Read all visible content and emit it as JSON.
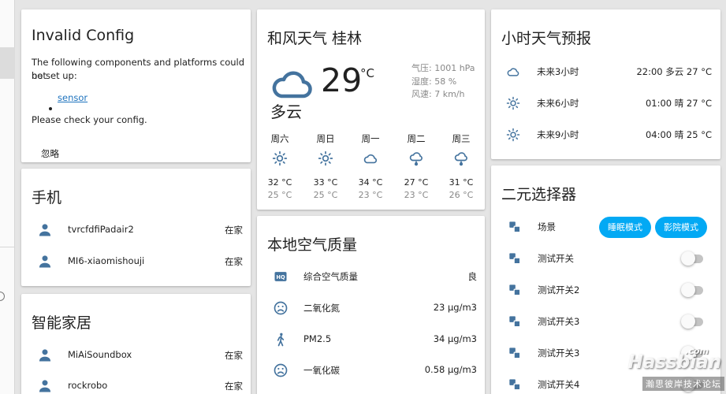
{
  "invalid_config": {
    "title": "Invalid Config",
    "message_line1": "The following components and platforms could not",
    "message_line2": "be set up:",
    "components": [
      "sensor"
    ],
    "check_text": "Please check your config.",
    "dismiss_label": "忽略"
  },
  "phone_card": {
    "title": "手机",
    "items": [
      {
        "icon": "person-icon",
        "name": "tvrcfdfiPadair2",
        "state": "在家"
      },
      {
        "icon": "person-icon",
        "name": "MI6-xiaomishouji",
        "state": "在家"
      }
    ]
  },
  "smart_home_card": {
    "title": "智能家居",
    "items": [
      {
        "icon": "person-icon",
        "name": "MiAiSoundbox",
        "state": "在家"
      },
      {
        "icon": "person-icon",
        "name": "rockrobo",
        "state": "在家"
      }
    ]
  },
  "weather_card": {
    "title": "和风天气 桂林",
    "current_icon": "cloudy-icon",
    "temperature": "29",
    "unit": "°C",
    "condition": "多云",
    "pressure": "气压: 1001 hPa",
    "humidity": "湿度: 58 %",
    "wind": "风速: 7 km/h",
    "forecast": [
      {
        "day": "周六",
        "icon": "sunny-icon",
        "high": "32 °C",
        "low": "25 °C"
      },
      {
        "day": "周日",
        "icon": "sunny-icon",
        "high": "33 °C",
        "low": "25 °C"
      },
      {
        "day": "周一",
        "icon": "cloudy-icon",
        "high": "34 °C",
        "low": "23 °C"
      },
      {
        "day": "周二",
        "icon": "rainy-icon",
        "high": "27 °C",
        "low": "23 °C"
      },
      {
        "day": "周三",
        "icon": "rainy-icon",
        "high": "31 °C",
        "low": "26 °C"
      }
    ]
  },
  "air_quality_card": {
    "title": "本地空气质量",
    "items": [
      {
        "icon": "hq-icon",
        "name": "综合空气质量",
        "value": "良"
      },
      {
        "icon": "sad-face-icon",
        "name": "二氧化氮",
        "value": "23 μg/m3"
      },
      {
        "icon": "walking-icon",
        "name": "PM2.5",
        "value": "34 μg/m3"
      },
      {
        "icon": "sad-face-icon",
        "name": "一氧化碳",
        "value": "0.58 μg/m3"
      }
    ]
  },
  "hourly_card": {
    "title": "小时天气预报",
    "items": [
      {
        "icon": "cloudy-icon",
        "label": "未来3小时",
        "value": "22:00 多云 27 °C"
      },
      {
        "icon": "sunny-icon",
        "label": "未来6小时",
        "value": "01:00 晴 27 °C"
      },
      {
        "icon": "sunny-icon",
        "label": "未来9小时",
        "value": "04:00 晴 25 °C"
      }
    ]
  },
  "binary_selector_card": {
    "title": "二元选择器",
    "scene": {
      "icon": "scene-icon",
      "label": "场景",
      "buttons": [
        "睡眠模式",
        "影院模式"
      ]
    },
    "switches": [
      {
        "icon": "switch-icon",
        "label": "测试开关",
        "on": false
      },
      {
        "icon": "switch-icon",
        "label": "测试开关2",
        "on": false
      },
      {
        "icon": "switch-icon",
        "label": "测试开关3",
        "on": false
      },
      {
        "icon": "switch-icon",
        "label": "测试开关3",
        "on": false
      },
      {
        "icon": "switch-icon",
        "label": "测试开关4",
        "on": false
      }
    ]
  },
  "watermark": {
    "brand": "Hassbian",
    "suffix": ".com",
    "sub": "瀚思彼岸技术论坛"
  },
  "colors": {
    "icon": "#44739e",
    "accent": "#03a9f4",
    "background": "#e5e5e5"
  }
}
